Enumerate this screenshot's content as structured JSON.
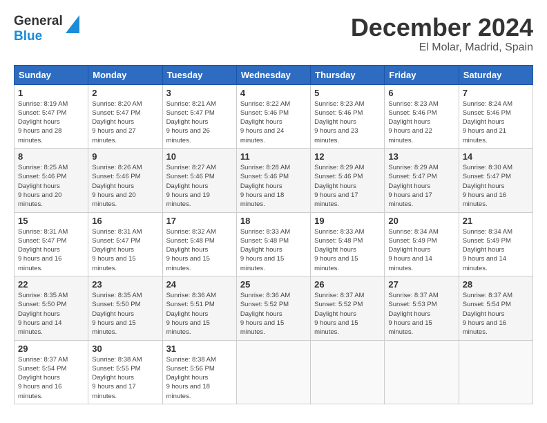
{
  "header": {
    "logo_line1": "General",
    "logo_line2": "Blue",
    "month_title": "December 2024",
    "location": "El Molar, Madrid, Spain"
  },
  "weekdays": [
    "Sunday",
    "Monday",
    "Tuesday",
    "Wednesday",
    "Thursday",
    "Friday",
    "Saturday"
  ],
  "weeks": [
    [
      {
        "day": "1",
        "sunrise": "8:19 AM",
        "sunset": "5:47 PM",
        "daylight": "9 hours and 28 minutes."
      },
      {
        "day": "2",
        "sunrise": "8:20 AM",
        "sunset": "5:47 PM",
        "daylight": "9 hours and 27 minutes."
      },
      {
        "day": "3",
        "sunrise": "8:21 AM",
        "sunset": "5:47 PM",
        "daylight": "9 hours and 26 minutes."
      },
      {
        "day": "4",
        "sunrise": "8:22 AM",
        "sunset": "5:46 PM",
        "daylight": "9 hours and 24 minutes."
      },
      {
        "day": "5",
        "sunrise": "8:23 AM",
        "sunset": "5:46 PM",
        "daylight": "9 hours and 23 minutes."
      },
      {
        "day": "6",
        "sunrise": "8:23 AM",
        "sunset": "5:46 PM",
        "daylight": "9 hours and 22 minutes."
      },
      {
        "day": "7",
        "sunrise": "8:24 AM",
        "sunset": "5:46 PM",
        "daylight": "9 hours and 21 minutes."
      }
    ],
    [
      {
        "day": "8",
        "sunrise": "8:25 AM",
        "sunset": "5:46 PM",
        "daylight": "9 hours and 20 minutes."
      },
      {
        "day": "9",
        "sunrise": "8:26 AM",
        "sunset": "5:46 PM",
        "daylight": "9 hours and 20 minutes."
      },
      {
        "day": "10",
        "sunrise": "8:27 AM",
        "sunset": "5:46 PM",
        "daylight": "9 hours and 19 minutes."
      },
      {
        "day": "11",
        "sunrise": "8:28 AM",
        "sunset": "5:46 PM",
        "daylight": "9 hours and 18 minutes."
      },
      {
        "day": "12",
        "sunrise": "8:29 AM",
        "sunset": "5:46 PM",
        "daylight": "9 hours and 17 minutes."
      },
      {
        "day": "13",
        "sunrise": "8:29 AM",
        "sunset": "5:47 PM",
        "daylight": "9 hours and 17 minutes."
      },
      {
        "day": "14",
        "sunrise": "8:30 AM",
        "sunset": "5:47 PM",
        "daylight": "9 hours and 16 minutes."
      }
    ],
    [
      {
        "day": "15",
        "sunrise": "8:31 AM",
        "sunset": "5:47 PM",
        "daylight": "9 hours and 16 minutes."
      },
      {
        "day": "16",
        "sunrise": "8:31 AM",
        "sunset": "5:47 PM",
        "daylight": "9 hours and 15 minutes."
      },
      {
        "day": "17",
        "sunrise": "8:32 AM",
        "sunset": "5:48 PM",
        "daylight": "9 hours and 15 minutes."
      },
      {
        "day": "18",
        "sunrise": "8:33 AM",
        "sunset": "5:48 PM",
        "daylight": "9 hours and 15 minutes."
      },
      {
        "day": "19",
        "sunrise": "8:33 AM",
        "sunset": "5:48 PM",
        "daylight": "9 hours and 15 minutes."
      },
      {
        "day": "20",
        "sunrise": "8:34 AM",
        "sunset": "5:49 PM",
        "daylight": "9 hours and 14 minutes."
      },
      {
        "day": "21",
        "sunrise": "8:34 AM",
        "sunset": "5:49 PM",
        "daylight": "9 hours and 14 minutes."
      }
    ],
    [
      {
        "day": "22",
        "sunrise": "8:35 AM",
        "sunset": "5:50 PM",
        "daylight": "9 hours and 14 minutes."
      },
      {
        "day": "23",
        "sunrise": "8:35 AM",
        "sunset": "5:50 PM",
        "daylight": "9 hours and 15 minutes."
      },
      {
        "day": "24",
        "sunrise": "8:36 AM",
        "sunset": "5:51 PM",
        "daylight": "9 hours and 15 minutes."
      },
      {
        "day": "25",
        "sunrise": "8:36 AM",
        "sunset": "5:52 PM",
        "daylight": "9 hours and 15 minutes."
      },
      {
        "day": "26",
        "sunrise": "8:37 AM",
        "sunset": "5:52 PM",
        "daylight": "9 hours and 15 minutes."
      },
      {
        "day": "27",
        "sunrise": "8:37 AM",
        "sunset": "5:53 PM",
        "daylight": "9 hours and 15 minutes."
      },
      {
        "day": "28",
        "sunrise": "8:37 AM",
        "sunset": "5:54 PM",
        "daylight": "9 hours and 16 minutes."
      }
    ],
    [
      {
        "day": "29",
        "sunrise": "8:37 AM",
        "sunset": "5:54 PM",
        "daylight": "9 hours and 16 minutes."
      },
      {
        "day": "30",
        "sunrise": "8:38 AM",
        "sunset": "5:55 PM",
        "daylight": "9 hours and 17 minutes."
      },
      {
        "day": "31",
        "sunrise": "8:38 AM",
        "sunset": "5:56 PM",
        "daylight": "9 hours and 18 minutes."
      },
      null,
      null,
      null,
      null
    ]
  ],
  "labels": {
    "sunrise": "Sunrise:",
    "sunset": "Sunset:",
    "daylight": "Daylight hours"
  }
}
